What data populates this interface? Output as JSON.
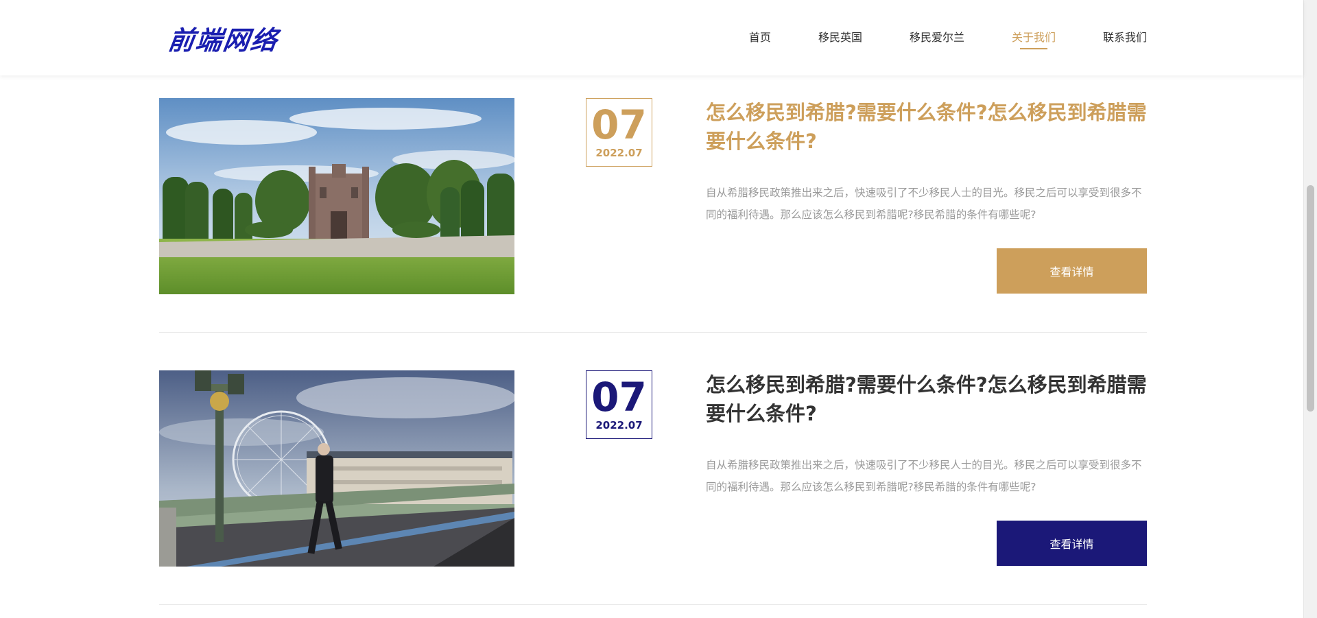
{
  "header": {
    "logo": "前端网络",
    "nav": [
      {
        "label": "首页",
        "active": false
      },
      {
        "label": "移民英国",
        "active": false
      },
      {
        "label": "移民爱尔兰",
        "active": false
      },
      {
        "label": "关于我们",
        "active": true
      },
      {
        "label": "联系我们",
        "active": false
      }
    ]
  },
  "colors": {
    "accent_gold": "#cd9f5b",
    "accent_navy": "#1b1878",
    "logo_blue": "#1a1eb0",
    "text_dark": "#333333",
    "text_muted": "#9a9a9a"
  },
  "articles": [
    {
      "image": "castle-garden-photo",
      "day": "07",
      "year_month": "2022.07",
      "title": "怎么移民到希腊?需要什么条件?怎么移民到希腊需要什么条件?",
      "description": "自从希腊移民政策推出来之后，快速吸引了不少移民人士的目光。移民之后可以享受到很多不同的福利待遇。那么应该怎么移民到希腊呢?移民希腊的条件有哪些呢?",
      "button": "查看详情",
      "state": "hover"
    },
    {
      "image": "london-bridge-photo",
      "day": "07",
      "year_month": "2022.07",
      "title": "怎么移民到希腊?需要什么条件?怎么移民到希腊需要什么条件?",
      "description": "自从希腊移民政策推出来之后，快速吸引了不少移民人士的目光。移民之后可以享受到很多不同的福利待遇。那么应该怎么移民到希腊呢?移民希腊的条件有哪些呢?",
      "button": "查看详情",
      "state": "normal"
    }
  ]
}
